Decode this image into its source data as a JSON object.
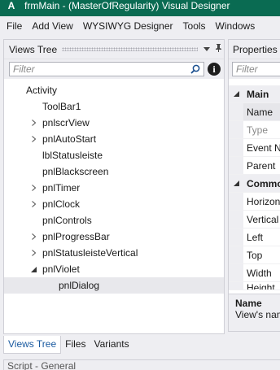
{
  "window": {
    "title": "frmMain - (MasterOfRegularity) Visual Designer"
  },
  "menu": [
    "File",
    "Add View",
    "WYSIWYG Designer",
    "Tools",
    "Windows"
  ],
  "views_tree": {
    "header": "Views Tree",
    "filter_placeholder": "Filter",
    "nodes": [
      {
        "label": "Activity"
      },
      {
        "label": "ToolBar1"
      },
      {
        "label": "pnlscrView"
      },
      {
        "label": "pnlAutoStart"
      },
      {
        "label": "lblStatusleiste"
      },
      {
        "label": "pnlBlackscreen"
      },
      {
        "label": "pnlTimer"
      },
      {
        "label": "pnlClock"
      },
      {
        "label": "pnlControls"
      },
      {
        "label": "pnlProgressBar"
      },
      {
        "label": "pnlStatusleisteVertical"
      },
      {
        "label": "pnlViolet"
      },
      {
        "label": "pnlDialog"
      }
    ]
  },
  "bottom_tabs": [
    "Views Tree",
    "Files",
    "Variants"
  ],
  "script_panel": {
    "header": "Script - General"
  },
  "properties": {
    "header": "Properties",
    "filter_placeholder": "Filter",
    "rows": [
      {
        "name": "Main"
      },
      {
        "name": "Name"
      },
      {
        "name": "Type"
      },
      {
        "name": "Event N"
      },
      {
        "name": "Parent"
      },
      {
        "name": "Commo"
      },
      {
        "name": "Horizon"
      },
      {
        "name": "Vertical"
      },
      {
        "name": "Left"
      },
      {
        "name": "Top"
      },
      {
        "name": "Width"
      },
      {
        "name": "Height"
      }
    ],
    "description": {
      "title": "Name",
      "text": "View's nam"
    }
  },
  "colors": {
    "titlebar": "#0a6b52",
    "active_tab_text": "#1a5aa0",
    "selection": "#e8e8ec"
  }
}
